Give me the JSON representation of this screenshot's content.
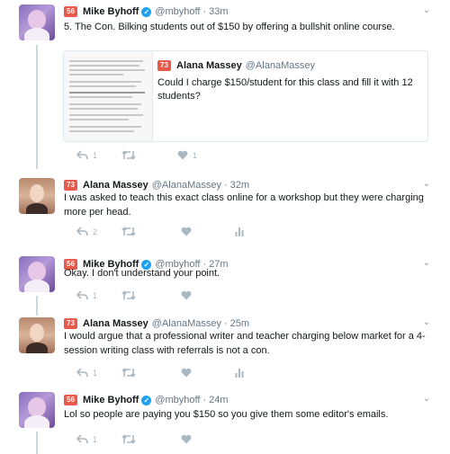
{
  "tweets": [
    {
      "author": "Mike Byhoff",
      "handle": "@mbyhoff",
      "time": "33m",
      "badge": "56",
      "text": "5. The Con. Bilking students out of $150 by offering a bullshit online course.",
      "quote": {
        "badge": "73",
        "author": "Alana Massey",
        "handle": "@AlanaMassey",
        "text": "Could I charge $150/student for this class and fill it with 12 students?"
      },
      "reply_count": "1",
      "retweet_count": "",
      "like_count": "1"
    },
    {
      "author": "Alana Massey",
      "handle": "@AlanaMassey",
      "time": "32m",
      "badge": "73",
      "text": "I was asked to teach this exact class online for a workshop but they were charging more per head.",
      "reply_count": "2",
      "retweet_count": "",
      "like_count": ""
    },
    {
      "author": "Mike Byhoff",
      "handle": "@mbyhoff",
      "time": "27m",
      "badge": "56",
      "text": "Okay. I don't understand your point.",
      "reply_count": "1",
      "retweet_count": "",
      "like_count": ""
    },
    {
      "author": "Alana Massey",
      "handle": "@AlanaMassey",
      "time": "25m",
      "badge": "73",
      "text": "I would argue that a professional writer and teacher charging below market for a 4-session writing class with referrals is not a con.",
      "reply_count": "1",
      "retweet_count": "",
      "like_count": ""
    },
    {
      "author": "Mike Byhoff",
      "handle": "@mbyhoff",
      "time": "24m",
      "badge": "56",
      "text": "Lol so people are paying you $150 so you give them some editor's emails.",
      "reply_count": "1",
      "retweet_count": "",
      "like_count": ""
    }
  ],
  "separator": "·",
  "caret": "⌄",
  "colors": {
    "badge": "#e8594c",
    "verified": "#1da1f2",
    "icon": "#aab8c2",
    "border": "#e1e8ed",
    "muted": "#657786"
  },
  "icons": [
    "reply-icon",
    "retweet-icon",
    "like-icon",
    "analytics-icon",
    "verified-icon",
    "caret-down-icon"
  ]
}
